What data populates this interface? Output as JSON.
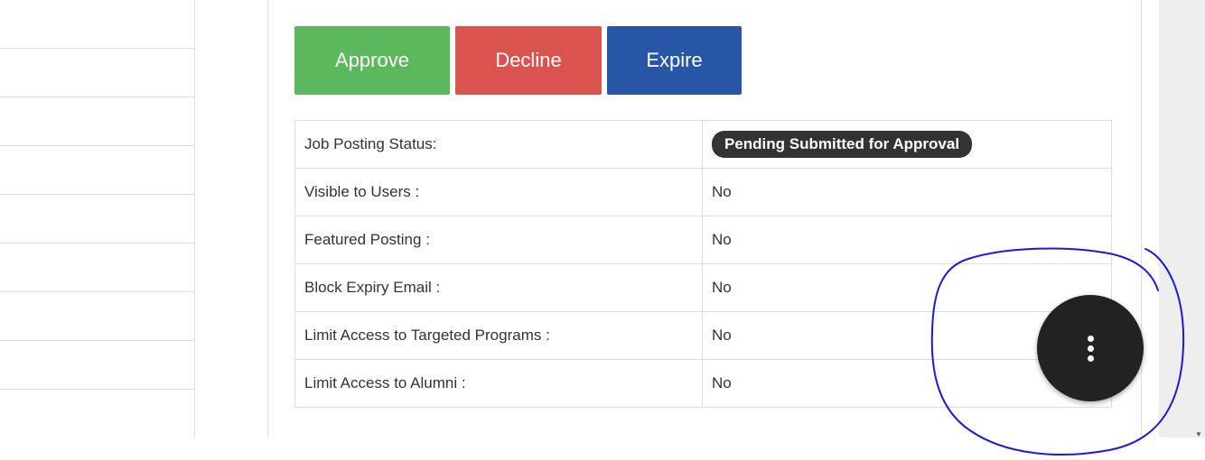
{
  "actions": {
    "approve_label": "Approve",
    "decline_label": "Decline",
    "expire_label": "Expire"
  },
  "details": {
    "rows": [
      {
        "label": "Job Posting Status:",
        "value": "Pending Submitted for Approval",
        "badge": true
      },
      {
        "label": "Visible to Users :",
        "value": "No"
      },
      {
        "label": "Featured Posting :",
        "value": "No"
      },
      {
        "label": "Block Expiry Email :",
        "value": "No"
      },
      {
        "label": "Limit Access to Targeted Programs :",
        "value": "No"
      },
      {
        "label": "Limit Access to Alumni :",
        "value": "No"
      }
    ]
  },
  "fab": {
    "icon": "more-vertical-icon"
  },
  "colors": {
    "approve": "#5cb85c",
    "decline": "#d9534f",
    "expire": "#2856a6",
    "badge": "#333333",
    "fab": "#222222",
    "annotation": "#1a1adb"
  }
}
